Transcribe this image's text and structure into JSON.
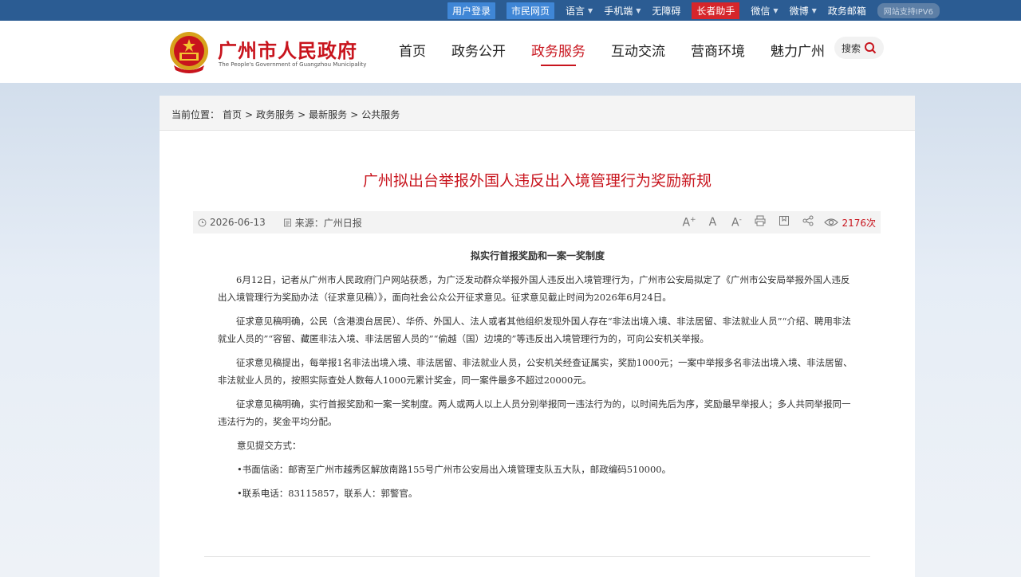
{
  "topbar": {
    "user_login": "用户登录",
    "citizen_page": "市民网页",
    "language": "语言",
    "mobile": "手机端",
    "accessibility": "无障碍",
    "elder_helper": "长者助手",
    "wechat": "微信",
    "weibo": "微博",
    "gov_mail": "政务邮箱",
    "ipv6": "网站支持IPV6"
  },
  "header": {
    "site_title": "广州市人民政府",
    "site_subtitle": "The People's Government of Guangzhou Municipality",
    "nav": [
      "首页",
      "政务公开",
      "政务服务",
      "互动交流",
      "营商环境",
      "魅力广州"
    ],
    "active_nav": "政务服务",
    "search_label": "搜索"
  },
  "breadcrumb": {
    "prefix": "当前位置：",
    "items": [
      "首页",
      "政务服务",
      "最新服务",
      "公共服务"
    ],
    "separator": ">"
  },
  "article": {
    "title": "广州拟出台举报外国人违反出入境管理行为奖励新规",
    "date": "2026-06-13",
    "source": "来源：广州日报",
    "views": "2176次",
    "subhead": "拟实行首报奖励和一案一奖制度",
    "paragraphs": [
      "6月12日，记者从广州市人民政府门户网站获悉，为广泛发动群众举报外国人违反出入境管理行为，广州市公安局拟定了《广州市公安局举报外国人违反出入境管理行为奖励办法（征求意见稿）》，面向社会公众公开征求意见。征求意见截止时间为2026年6月24日。",
      "征求意见稿明确，公民（含港澳台居民）、华侨、外国人、法人或者其他组织发现外国人存在“非法出境入境、非法居留、非法就业人员”“介绍、聘用非法就业人员的”“容留、藏匿非法入境、非法居留人员的”“偷越（国）边境的”等违反出入境管理行为的，可向公安机关举报。",
      "征求意见稿提出，每举报1名非法出境入境、非法居留、非法就业人员，公安机关经查证属实，奖励1000元；一案中举报多名非法出境入境、非法居留、非法就业人员的，按照实际查处人数每人1000元累计奖金，同一案件最多不超过20000元。",
      "征求意见稿明确，实行首报奖励和一案一奖制度。两人或两人以上人员分别举报同一违法行为的，以时间先后为序，奖励最早举报人；多人共同举报同一违法行为的，奖金平均分配。"
    ],
    "submit_heading": "意见提交方式：",
    "bullets": [
      "•书面信函：邮寄至广州市越秀区解放南路155号广州市公安局出入境管理支队五大队，邮政编码510000。",
      "•联系电话：83115857，联系人：郭警官。"
    ]
  },
  "colors": {
    "topbar": "#2b5c93",
    "brand_red": "#c8141d"
  }
}
